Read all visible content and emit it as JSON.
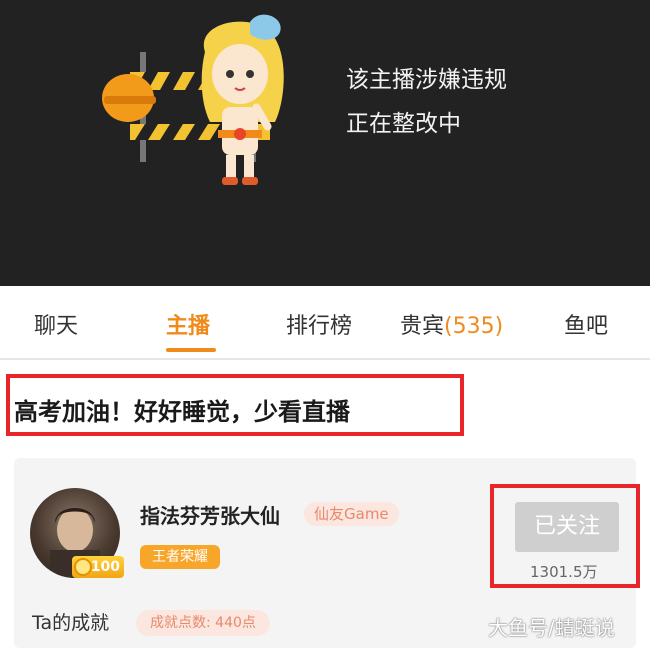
{
  "banner": {
    "line1": "该主播涉嫌违规",
    "line2": "正在整改中"
  },
  "tabs": [
    {
      "label": "聊天"
    },
    {
      "label": "主播"
    },
    {
      "label": "排行榜"
    },
    {
      "label": "贵宾",
      "count": "(535)"
    },
    {
      "label": "鱼吧"
    }
  ],
  "active_tab": "主播",
  "announcement": "高考加油！好好睡觉，少看直播",
  "streamer": {
    "name": "指法芬芳张大仙",
    "game_tag": "仙友Game",
    "rank_tag": "王者荣耀",
    "level": "100",
    "follow_label": "已关注",
    "followers": "1301.5万"
  },
  "achievement": {
    "label": "Ta的成就",
    "points": "成就点数: 440点"
  },
  "watermark": "大鱼号/蜻蜓说",
  "colors": {
    "accent": "#f08a1b",
    "highlight_box": "#e8252b",
    "banner_bg": "#222222"
  }
}
